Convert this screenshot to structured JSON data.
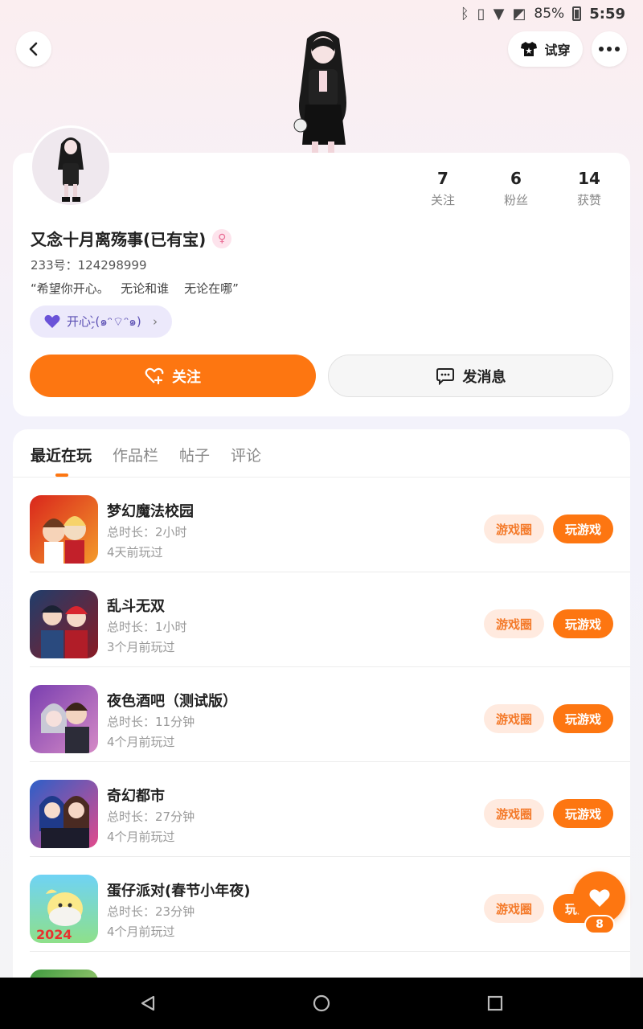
{
  "status_bar": {
    "battery_text": "85%",
    "time": "5:59"
  },
  "header": {
    "tryon_label": "试穿"
  },
  "profile": {
    "username": "又念十月离殇事(已有宝)",
    "gender_symbol": "♀",
    "uid": "233号：124298999",
    "bio": "“希望你开心。   无论和谁    无论在哪”",
    "mood": "开心-̗̀(๑ᵔ⌔ᵔ๑)",
    "stats": [
      {
        "value": "7",
        "label": "关注"
      },
      {
        "value": "6",
        "label": "粉丝"
      },
      {
        "value": "14",
        "label": "获赞"
      }
    ],
    "follow_label": "关注",
    "message_label": "发消息"
  },
  "tabs": [
    {
      "label": "最近在玩",
      "active": true
    },
    {
      "label": "作品栏",
      "active": false
    },
    {
      "label": "帖子",
      "active": false
    },
    {
      "label": "评论",
      "active": false
    }
  ],
  "games": [
    {
      "title": "梦幻魔法校园",
      "duration": "总时长：2小时",
      "last_played": "4天前玩过",
      "circle_label": "游戏圈",
      "play_label": "玩游戏"
    },
    {
      "title": "乱斗无双",
      "duration": "总时长：1小时",
      "last_played": "3个月前玩过",
      "circle_label": "游戏圈",
      "play_label": "玩游戏"
    },
    {
      "title": "夜色酒吧（测试版）",
      "duration": "总时长：11分钟",
      "last_played": "4个月前玩过",
      "circle_label": "游戏圈",
      "play_label": "玩游戏"
    },
    {
      "title": "奇幻都市",
      "duration": "总时长：27分钟",
      "last_played": "4个月前玩过",
      "circle_label": "游戏圈",
      "play_label": "玩游戏"
    },
    {
      "title": "蛋仔派对(春节小年夜)",
      "duration": "总时长：23分钟",
      "last_played": "4个月前玩过",
      "circle_label": "游戏圈",
      "play_label": "玩游戏"
    }
  ],
  "like_fab": {
    "count": "8"
  },
  "icons": {
    "back": "chevron-left-icon",
    "tryon": "shirt-icon",
    "more": "more-dots-icon",
    "follow": "heart-plus-icon",
    "message": "chat-bubble-icon",
    "mood": "purple-heart-icon",
    "like": "heart-icon"
  },
  "colors": {
    "accent": "#fd7611",
    "accent_light": "#ffeadf",
    "mood_bg": "#ece9fb",
    "mood_text": "#5b4fb3"
  }
}
